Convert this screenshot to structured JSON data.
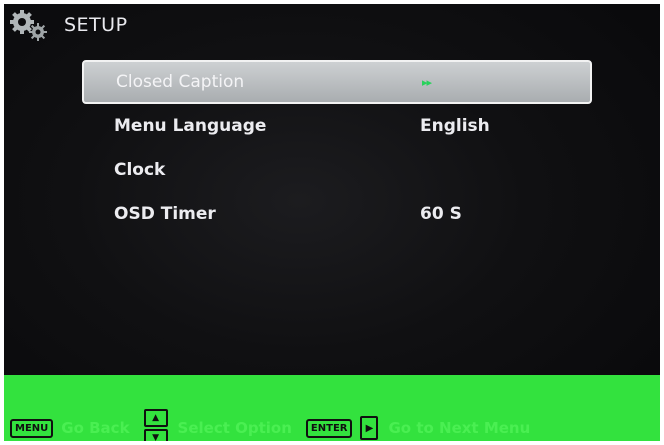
{
  "header": {
    "title": "SETUP",
    "icon": "gear-icon"
  },
  "menu": {
    "items": [
      {
        "label": "Closed Caption",
        "value": "▸▸",
        "selected": true
      },
      {
        "label": "Menu Language",
        "value": "English"
      },
      {
        "label": "Clock",
        "value": ""
      },
      {
        "label": "OSD Timer",
        "value": "60 S"
      }
    ]
  },
  "footer": {
    "menu_key": "MENU",
    "go_back": "Go Back",
    "select_hint": "Select Option",
    "enter_key": "ENTER",
    "next_hint": "Go to Next Menu"
  },
  "colors": {
    "footer_bg": "#33e23e",
    "cc_indicator": "#27d25a"
  }
}
